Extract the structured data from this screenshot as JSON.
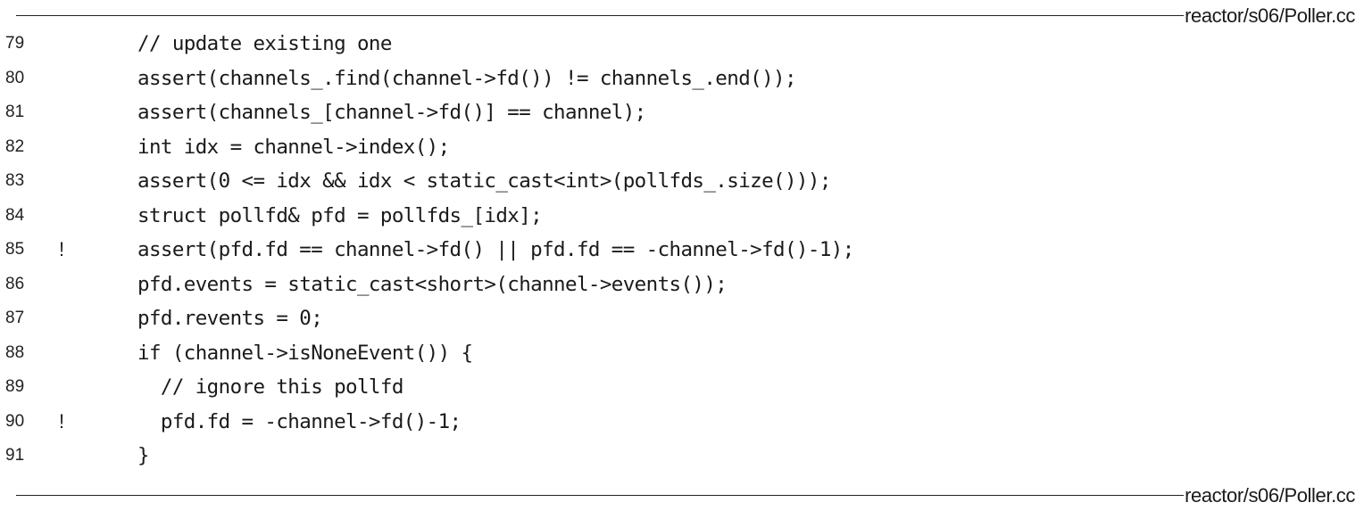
{
  "header": {
    "filename": "reactor/s06/Poller.cc"
  },
  "footer": {
    "filename": "reactor/s06/Poller.cc"
  },
  "code": {
    "lines": [
      {
        "number": "79",
        "marker": "",
        "text": "// update existing one"
      },
      {
        "number": "80",
        "marker": "",
        "text": "assert(channels_.find(channel->fd()) != channels_.end());"
      },
      {
        "number": "81",
        "marker": "",
        "text": "assert(channels_[channel->fd()] == channel);"
      },
      {
        "number": "82",
        "marker": "",
        "text": "int idx = channel->index();"
      },
      {
        "number": "83",
        "marker": "",
        "text": "assert(0 <= idx && idx < static_cast<int>(pollfds_.size()));"
      },
      {
        "number": "84",
        "marker": "",
        "text": "struct pollfd& pfd = pollfds_[idx];"
      },
      {
        "number": "85",
        "marker": "!",
        "text": "assert(pfd.fd == channel->fd() || pfd.fd == -channel->fd()-1);"
      },
      {
        "number": "86",
        "marker": "",
        "text": "pfd.events = static_cast<short>(channel->events());"
      },
      {
        "number": "87",
        "marker": "",
        "text": "pfd.revents = 0;"
      },
      {
        "number": "88",
        "marker": "",
        "text": "if (channel->isNoneEvent()) {"
      },
      {
        "number": "89",
        "marker": "",
        "text": "  // ignore this pollfd"
      },
      {
        "number": "90",
        "marker": "!",
        "text": "  pfd.fd = -channel->fd()-1;"
      },
      {
        "number": "91",
        "marker": "",
        "text": "}"
      }
    ]
  }
}
